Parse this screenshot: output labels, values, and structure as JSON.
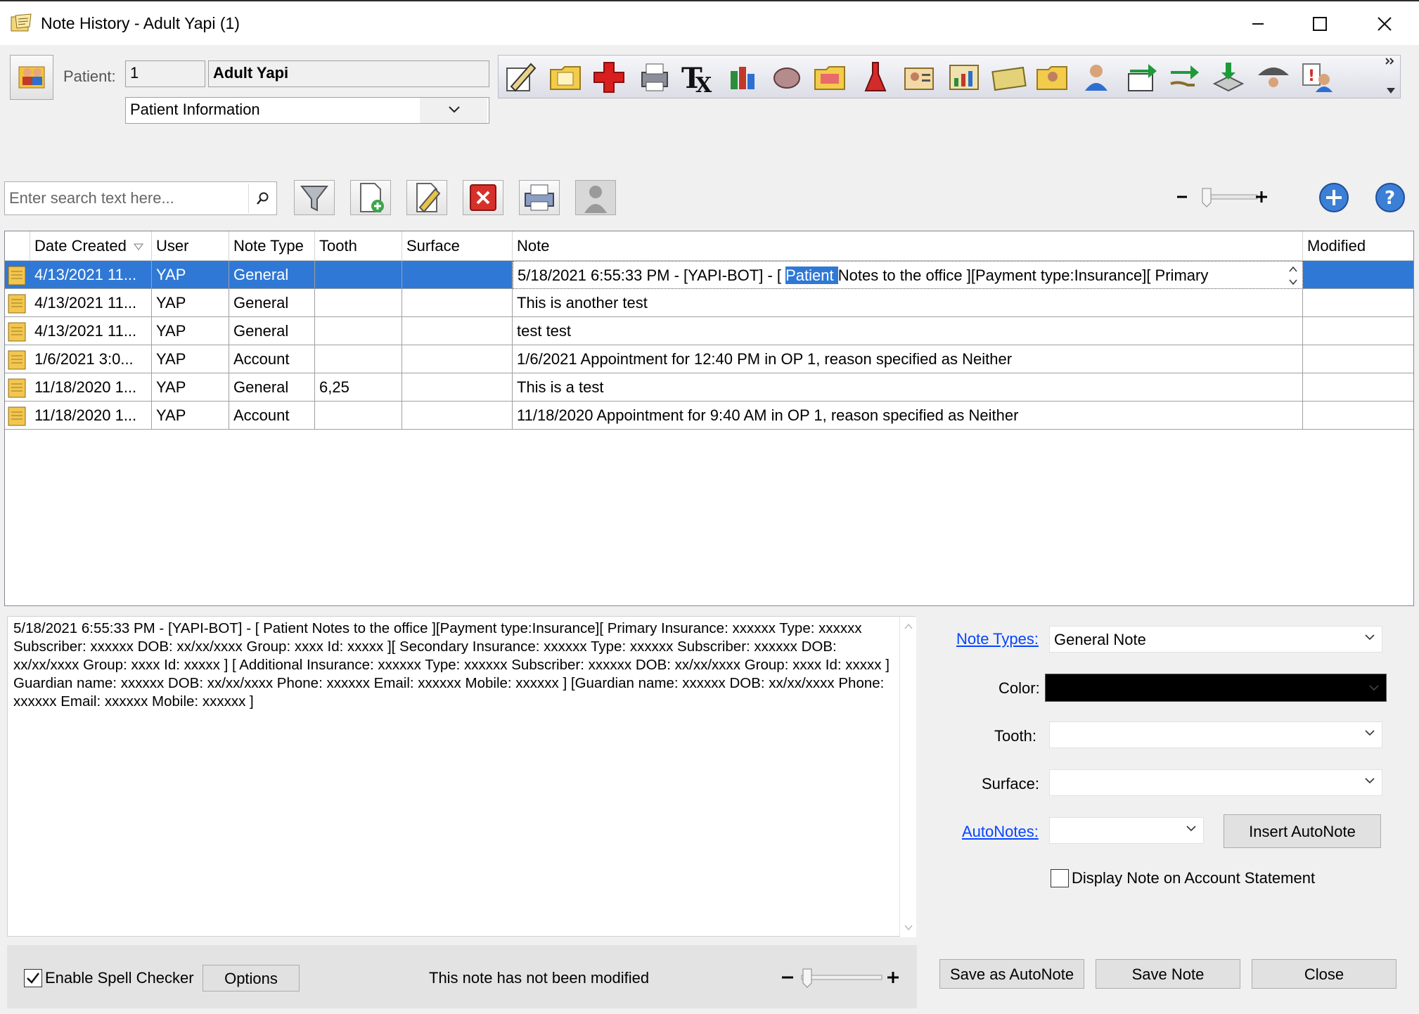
{
  "window": {
    "title": "Note History - Adult Yapi (1)",
    "controls": [
      "minimize",
      "maximize",
      "close"
    ]
  },
  "patient": {
    "label": "Patient:",
    "id": "1",
    "name": "Adult Yapi",
    "view_select": "Patient Information"
  },
  "toolbar_icons": [
    "edit-note-icon",
    "folder-note-icon",
    "medical-cross-icon",
    "printer-icon",
    "rx-icon",
    "family-icon",
    "brain-icon",
    "folder-card-icon",
    "red-flask-icon",
    "new-person-card-icon",
    "new-chart-icon",
    "insurance-card-icon",
    "folder-person-icon",
    "person-key-icon",
    "export-green-icon",
    "transfer-hand-icon",
    "download-tray-icon",
    "umbrella-person-icon",
    "alert-person-icon"
  ],
  "search": {
    "placeholder": "Enter search text here..."
  },
  "grid": {
    "columns": [
      "Date Created",
      "User",
      "Note Type",
      "Tooth",
      "Surface",
      "Note",
      "Modified"
    ],
    "rows": [
      {
        "date": "4/13/2021 11...",
        "user": "YAP",
        "type": "General",
        "tooth": "",
        "surface": "",
        "note_pre": "5/18/2021 6:55:33 PM - [YAPI-BOT] - [ ",
        "note_hl": "Patient ",
        "note_post": "Notes to the office ][Payment type:Insurance][ Primary",
        "modified": ""
      },
      {
        "date": "4/13/2021 11...",
        "user": "YAP",
        "type": "General",
        "tooth": "",
        "surface": "",
        "note": "This is another test",
        "modified": ""
      },
      {
        "date": "4/13/2021 11...",
        "user": "YAP",
        "type": "General",
        "tooth": "",
        "surface": "",
        "note": "test test",
        "modified": ""
      },
      {
        "date": "1/6/2021 3:0...",
        "user": "YAP",
        "type": "Account",
        "tooth": "",
        "surface": "",
        "note": "1/6/2021 Appointment for 12:40 PM in OP 1, reason specified as Neither",
        "modified": ""
      },
      {
        "date": "11/18/2020 1...",
        "user": "YAP",
        "type": "General",
        "tooth": "6,25",
        "surface": "",
        "note": "This is a test",
        "modified": ""
      },
      {
        "date": "11/18/2020 1...",
        "user": "YAP",
        "type": "Account",
        "tooth": "",
        "surface": "",
        "note": "11/18/2020 Appointment for 9:40 AM in OP 1, reason specified as Neither",
        "modified": ""
      }
    ]
  },
  "editor": {
    "text": "5/18/2021 6:55:33 PM - [YAPI-BOT] - [ Patient Notes to the office ][Payment type:Insurance][ Primary Insurance: xxxxxx Type: xxxxxx Subscriber: xxxxxx DOB: xx/xx/xxxx Group: xxxx Id: xxxxx ][ Secondary Insurance: xxxxxx Type: xxxxxx Subscriber: xxxxxx DOB: xx/xx/xxxx Group: xxxx Id: xxxxx ] [ Additional Insurance: xxxxxx Type: xxxxxx Subscriber: xxxxxx DOB: xx/xx/xxxx Group: xxxx Id: xxxxx ] Guardian name: xxxxxx DOB: xx/xx/xxxx Phone: xxxxxx Email: xxxxxx Mobile: xxxxxx ] [Guardian name: xxxxxx DOB: xx/xx/xxxx Phone: xxxxxx Email: xxxxxx Mobile: xxxxxx ]"
  },
  "status": {
    "spell_label": "Enable Spell Checker",
    "spell_checked": true,
    "options_label": "Options",
    "modified_text": "This note has not been modified"
  },
  "form": {
    "note_types_label": "Note Types:",
    "note_types_value": "General Note",
    "color_label": "Color:",
    "color_value": "#000000",
    "tooth_label": "Tooth:",
    "tooth_value": "",
    "surface_label": "Surface:",
    "surface_value": "",
    "autonotes_label": "AutoNotes:",
    "autonotes_value": "",
    "insert_autonote_label": "Insert AutoNote",
    "display_on_statement_label": "Display Note on Account Statement",
    "display_on_statement_checked": false
  },
  "buttons": {
    "save_as_autonote": "Save as AutoNote",
    "save_note": "Save Note",
    "close": "Close"
  },
  "colors": {
    "selection": "#2f78d6",
    "link": "#0645ff"
  }
}
